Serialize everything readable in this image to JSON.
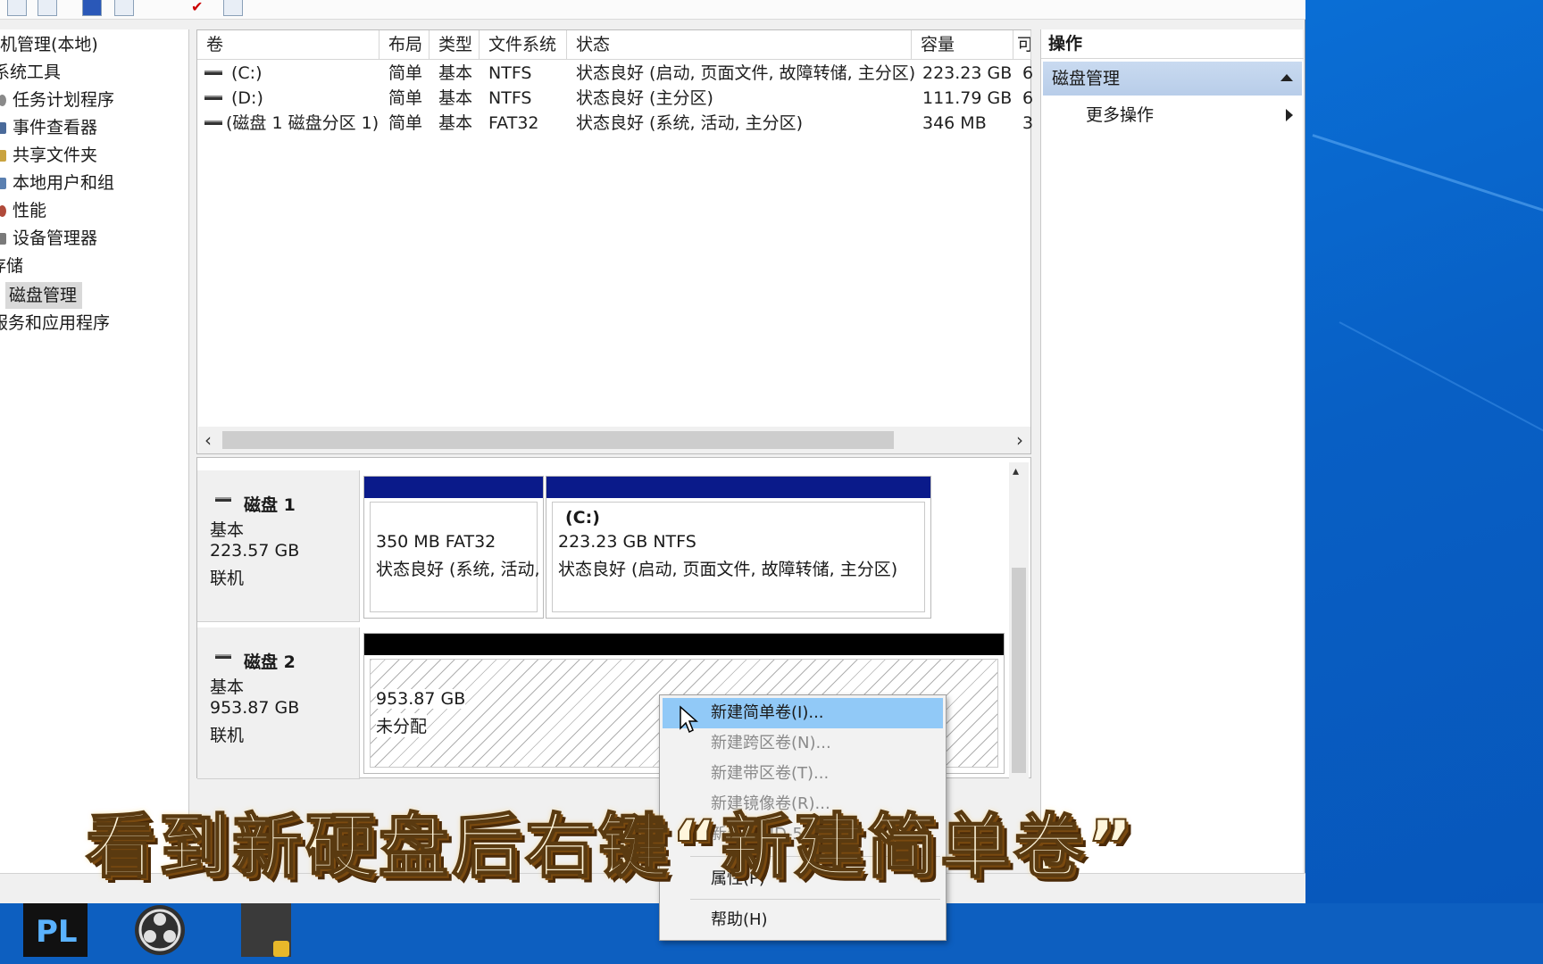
{
  "navigation": {
    "items": [
      {
        "label": "机管理(本地)",
        "icon": "computer-management-icon"
      },
      {
        "label": "系统工具",
        "icon": "tools-icon"
      },
      {
        "label": "任务计划程序",
        "icon": "clock-icon"
      },
      {
        "label": "事件查看器",
        "icon": "event-viewer-icon"
      },
      {
        "label": "共享文件夹",
        "icon": "folder-icon"
      },
      {
        "label": "本地用户和组",
        "icon": "users-icon"
      },
      {
        "label": "性能",
        "icon": "performance-icon"
      },
      {
        "label": "设备管理器",
        "icon": "device-manager-icon"
      },
      {
        "label": "存储",
        "icon": "storage-icon"
      },
      {
        "label": "磁盘管理",
        "icon": "disk-icon",
        "selected": true
      },
      {
        "label": "服务和应用程序",
        "icon": "services-icon"
      }
    ]
  },
  "volume_list": {
    "columns": [
      "卷",
      "布局",
      "类型",
      "文件系统",
      "状态",
      "容量",
      "可"
    ],
    "rows": [
      {
        "volume": "(C:)",
        "layout": "简单",
        "type": "基本",
        "fs": "NTFS",
        "status": "状态良好 (启动, 页面文件, 故障转储, 主分区)",
        "capacity": "223.23 GB",
        "free": "6"
      },
      {
        "volume": "(D:)",
        "layout": "简单",
        "type": "基本",
        "fs": "NTFS",
        "status": "状态良好 (主分区)",
        "capacity": "111.79 GB",
        "free": "6"
      },
      {
        "volume": "(磁盘 1 磁盘分区 1)",
        "layout": "简单",
        "type": "基本",
        "fs": "FAT32",
        "status": "状态良好 (系统, 活动, 主分区)",
        "capacity": "346 MB",
        "free": "3"
      }
    ]
  },
  "disks": [
    {
      "name": "磁盘 1",
      "kind": "基本",
      "size": "223.57 GB",
      "state": "联机",
      "partitions": [
        {
          "line1": "350 MB FAT32",
          "line2": "状态良好 (系统, 活动,"
        },
        {
          "title": "(C:)",
          "line1": "223.23 GB NTFS",
          "line2": "状态良好 (启动, 页面文件, 故障转储, 主分区)"
        }
      ]
    },
    {
      "name": "磁盘 2",
      "kind": "基本",
      "size": "953.87 GB",
      "state": "联机",
      "partitions": [
        {
          "line1": "953.87 GB",
          "line2": "未分配"
        }
      ]
    }
  ],
  "actions": {
    "header": "操作",
    "section": "磁盘管理",
    "more": "更多操作"
  },
  "context_menu": {
    "items": [
      {
        "label": "新建简单卷(I)...",
        "enabled": true,
        "highlighted": true
      },
      {
        "label": "新建跨区卷(N)...",
        "enabled": false
      },
      {
        "label": "新建带区卷(T)...",
        "enabled": false
      },
      {
        "label": "新建镜像卷(R)...",
        "enabled": false
      },
      {
        "label": "新建 RAID-5 卷(W)...",
        "enabled": false
      },
      {
        "label": "属性(P)",
        "enabled": true
      },
      {
        "label": "帮助(H)",
        "enabled": true
      }
    ]
  },
  "caption": "看到新硬盘后右键“新建简单卷”",
  "taskbar": {
    "apps": [
      {
        "label": "PL",
        "icon": "app-pl-icon"
      },
      {
        "label": "",
        "icon": "obs-icon"
      },
      {
        "label": "",
        "icon": "minecraft-icon"
      }
    ]
  },
  "colors": {
    "primary_partition_bar": "#0a1a8a",
    "unallocated_bar": "#000000",
    "menu_highlight": "#91c9f7",
    "desktop": "#0a6fd6"
  }
}
